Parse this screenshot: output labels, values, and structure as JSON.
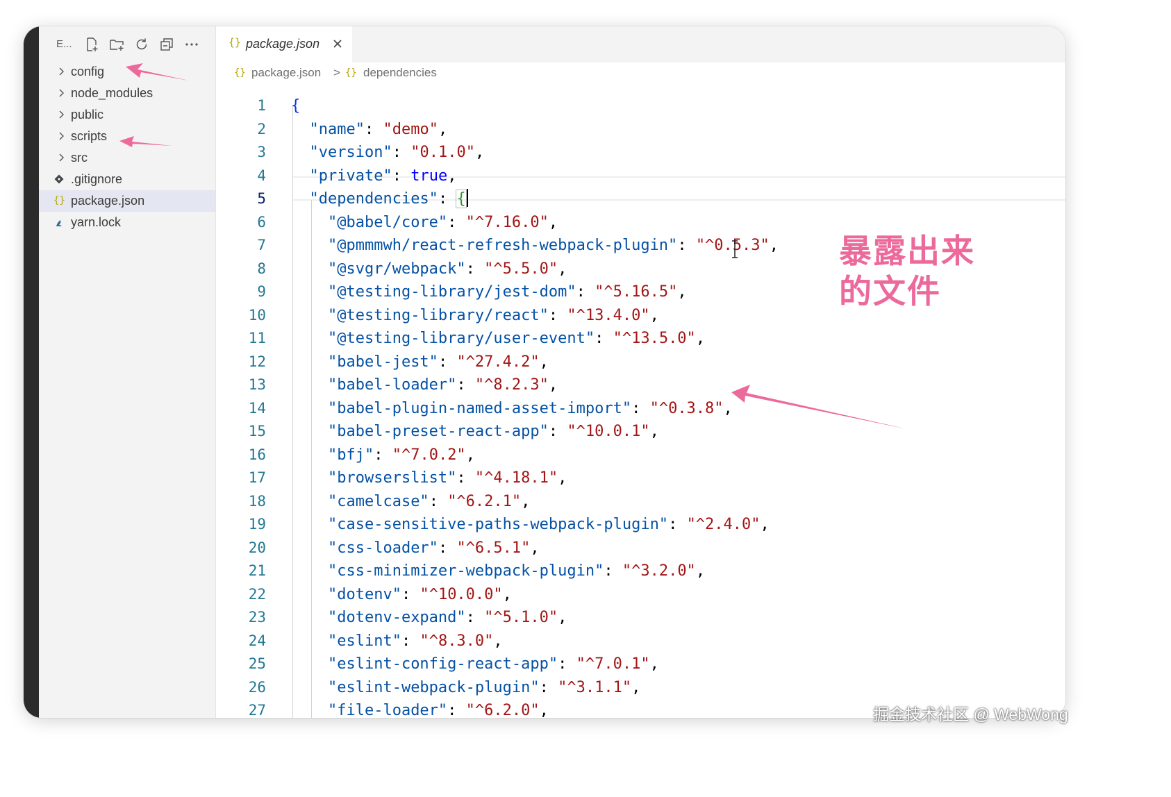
{
  "sidebar": {
    "title": "E...",
    "toolbar_icons": [
      "new-file-icon",
      "new-folder-icon",
      "refresh-icon",
      "collapse-all-icon",
      "more-actions-icon"
    ],
    "items": [
      {
        "label": "config",
        "type": "folder"
      },
      {
        "label": "node_modules",
        "type": "folder"
      },
      {
        "label": "public",
        "type": "folder"
      },
      {
        "label": "scripts",
        "type": "folder"
      },
      {
        "label": "src",
        "type": "folder"
      },
      {
        "label": ".gitignore",
        "type": "file",
        "icon": "git-icon"
      },
      {
        "label": "package.json",
        "type": "file",
        "icon": "json-icon",
        "active": true
      },
      {
        "label": "yarn.lock",
        "type": "file",
        "icon": "yarn-icon"
      }
    ]
  },
  "tab": {
    "icon_text": "{}",
    "label": "package.json"
  },
  "breadcrumb": {
    "icon_text": "{}",
    "file": "package.json",
    "separator": ">",
    "symbol": "dependencies"
  },
  "editor": {
    "current_line": 5,
    "line_numbers": [
      "1",
      "2",
      "3",
      "4",
      "5",
      "6",
      "7",
      "8",
      "9",
      "10",
      "11",
      "12",
      "13",
      "14",
      "15",
      "16",
      "17",
      "18",
      "19",
      "20",
      "21",
      "22",
      "23",
      "24",
      "25",
      "26",
      "27"
    ],
    "lines": [
      [
        [
          "{",
          "brace"
        ]
      ],
      [
        [
          "  ",
          "punc"
        ],
        [
          "\"name\"",
          "key"
        ],
        [
          ": ",
          "punc"
        ],
        [
          "\"demo\"",
          "str"
        ],
        [
          ",",
          "punc"
        ]
      ],
      [
        [
          "  ",
          "punc"
        ],
        [
          "\"version\"",
          "key"
        ],
        [
          ": ",
          "punc"
        ],
        [
          "\"0.1.0\"",
          "str"
        ],
        [
          ",",
          "punc"
        ]
      ],
      [
        [
          "  ",
          "punc"
        ],
        [
          "\"private\"",
          "key"
        ],
        [
          ": ",
          "punc"
        ],
        [
          "true",
          "bool"
        ],
        [
          ",",
          "punc"
        ]
      ],
      [
        [
          "  ",
          "punc"
        ],
        [
          "\"dependencies\"",
          "key"
        ],
        [
          ": ",
          "punc"
        ],
        [
          "{",
          "brace-match"
        ],
        [
          "",
          "caret"
        ]
      ],
      [
        [
          "    ",
          "punc"
        ],
        [
          "\"@babel/core\"",
          "key"
        ],
        [
          ": ",
          "punc"
        ],
        [
          "\"^7.16.0\"",
          "str"
        ],
        [
          ",",
          "punc"
        ]
      ],
      [
        [
          "    ",
          "punc"
        ],
        [
          "\"@pmmmwh/react-refresh-webpack-plugin\"",
          "key"
        ],
        [
          ": ",
          "punc"
        ],
        [
          "\"^0.5.3\"",
          "str"
        ],
        [
          ",",
          "punc"
        ]
      ],
      [
        [
          "    ",
          "punc"
        ],
        [
          "\"@svgr/webpack\"",
          "key"
        ],
        [
          ": ",
          "punc"
        ],
        [
          "\"^5.5.0\"",
          "str"
        ],
        [
          ",",
          "punc"
        ]
      ],
      [
        [
          "    ",
          "punc"
        ],
        [
          "\"@testing-library/jest-dom\"",
          "key"
        ],
        [
          ": ",
          "punc"
        ],
        [
          "\"^5.16.5\"",
          "str"
        ],
        [
          ",",
          "punc"
        ]
      ],
      [
        [
          "    ",
          "punc"
        ],
        [
          "\"@testing-library/react\"",
          "key"
        ],
        [
          ": ",
          "punc"
        ],
        [
          "\"^13.4.0\"",
          "str"
        ],
        [
          ",",
          "punc"
        ]
      ],
      [
        [
          "    ",
          "punc"
        ],
        [
          "\"@testing-library/user-event\"",
          "key"
        ],
        [
          ": ",
          "punc"
        ],
        [
          "\"^13.5.0\"",
          "str"
        ],
        [
          ",",
          "punc"
        ]
      ],
      [
        [
          "    ",
          "punc"
        ],
        [
          "\"babel-jest\"",
          "key"
        ],
        [
          ": ",
          "punc"
        ],
        [
          "\"^27.4.2\"",
          "str"
        ],
        [
          ",",
          "punc"
        ]
      ],
      [
        [
          "    ",
          "punc"
        ],
        [
          "\"babel-loader\"",
          "key"
        ],
        [
          ": ",
          "punc"
        ],
        [
          "\"^8.2.3\"",
          "str"
        ],
        [
          ",",
          "punc"
        ]
      ],
      [
        [
          "    ",
          "punc"
        ],
        [
          "\"babel-plugin-named-asset-import\"",
          "key"
        ],
        [
          ": ",
          "punc"
        ],
        [
          "\"^0.3.8\"",
          "str"
        ],
        [
          ",",
          "punc"
        ]
      ],
      [
        [
          "    ",
          "punc"
        ],
        [
          "\"babel-preset-react-app\"",
          "key"
        ],
        [
          ": ",
          "punc"
        ],
        [
          "\"^10.0.1\"",
          "str"
        ],
        [
          ",",
          "punc"
        ]
      ],
      [
        [
          "    ",
          "punc"
        ],
        [
          "\"bfj\"",
          "key"
        ],
        [
          ": ",
          "punc"
        ],
        [
          "\"^7.0.2\"",
          "str"
        ],
        [
          ",",
          "punc"
        ]
      ],
      [
        [
          "    ",
          "punc"
        ],
        [
          "\"browserslist\"",
          "key"
        ],
        [
          ": ",
          "punc"
        ],
        [
          "\"^4.18.1\"",
          "str"
        ],
        [
          ",",
          "punc"
        ]
      ],
      [
        [
          "    ",
          "punc"
        ],
        [
          "\"camelcase\"",
          "key"
        ],
        [
          ": ",
          "punc"
        ],
        [
          "\"^6.2.1\"",
          "str"
        ],
        [
          ",",
          "punc"
        ]
      ],
      [
        [
          "    ",
          "punc"
        ],
        [
          "\"case-sensitive-paths-webpack-plugin\"",
          "key"
        ],
        [
          ": ",
          "punc"
        ],
        [
          "\"^2.4.0\"",
          "str"
        ],
        [
          ",",
          "punc"
        ]
      ],
      [
        [
          "    ",
          "punc"
        ],
        [
          "\"css-loader\"",
          "key"
        ],
        [
          ": ",
          "punc"
        ],
        [
          "\"^6.5.1\"",
          "str"
        ],
        [
          ",",
          "punc"
        ]
      ],
      [
        [
          "    ",
          "punc"
        ],
        [
          "\"css-minimizer-webpack-plugin\"",
          "key"
        ],
        [
          ": ",
          "punc"
        ],
        [
          "\"^3.2.0\"",
          "str"
        ],
        [
          ",",
          "punc"
        ]
      ],
      [
        [
          "    ",
          "punc"
        ],
        [
          "\"dotenv\"",
          "key"
        ],
        [
          ": ",
          "punc"
        ],
        [
          "\"^10.0.0\"",
          "str"
        ],
        [
          ",",
          "punc"
        ]
      ],
      [
        [
          "    ",
          "punc"
        ],
        [
          "\"dotenv-expand\"",
          "key"
        ],
        [
          ": ",
          "punc"
        ],
        [
          "\"^5.1.0\"",
          "str"
        ],
        [
          ",",
          "punc"
        ]
      ],
      [
        [
          "    ",
          "punc"
        ],
        [
          "\"eslint\"",
          "key"
        ],
        [
          ": ",
          "punc"
        ],
        [
          "\"^8.3.0\"",
          "str"
        ],
        [
          ",",
          "punc"
        ]
      ],
      [
        [
          "    ",
          "punc"
        ],
        [
          "\"eslint-config-react-app\"",
          "key"
        ],
        [
          ": ",
          "punc"
        ],
        [
          "\"^7.0.1\"",
          "str"
        ],
        [
          ",",
          "punc"
        ]
      ],
      [
        [
          "    ",
          "punc"
        ],
        [
          "\"eslint-webpack-plugin\"",
          "key"
        ],
        [
          ": ",
          "punc"
        ],
        [
          "\"^3.1.1\"",
          "str"
        ],
        [
          ",",
          "punc"
        ]
      ],
      [
        [
          "    ",
          "punc"
        ],
        [
          "\"file-loader\"",
          "key"
        ],
        [
          ": ",
          "punc"
        ],
        [
          "\"^6.2.0\"",
          "str"
        ],
        [
          ",",
          "punc"
        ]
      ]
    ]
  },
  "annotation": {
    "line1": "暴露出来",
    "line2": "的文件",
    "color": "#ec6a9b"
  },
  "watermark": "掘金技术社区 @ WebWong",
  "colors": {
    "key": "#0451a5",
    "string": "#a31515",
    "bool": "#0000ff",
    "line_number": "#237893",
    "arrow": "#ec6a9b"
  }
}
